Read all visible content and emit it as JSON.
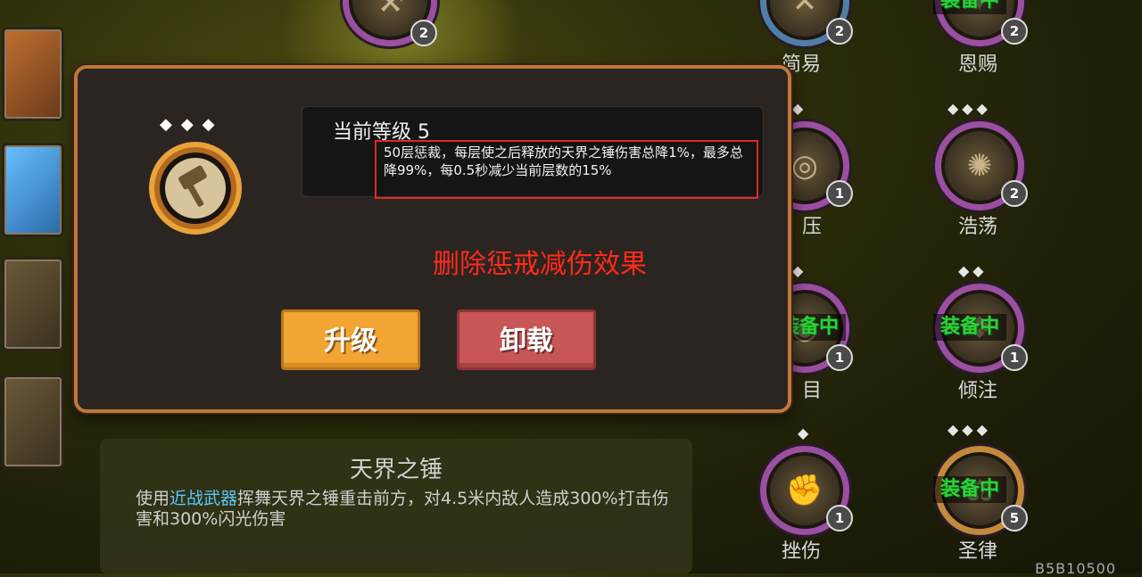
{
  "modal": {
    "level_label": "当前等级 5",
    "effect_desc": "50层惩裁，每层使之后释放的天界之锤伤害总降1%，最多总降99%，每0.5秒减少当前层数的15%",
    "annotation": "删除惩戒减伤效果",
    "upgrade_label": "升级",
    "unload_label": "卸载"
  },
  "skill_panel": {
    "title": "天界之锤",
    "desc_prefix": "使用",
    "desc_highlight": "近战武器",
    "desc_rest": "挥舞天界之锤重击前方，对4.5米内敌人造成300%打击伤害和300%闪光伤害"
  },
  "right_skills": [
    {
      "name": "简易",
      "level": "2",
      "equipped": false
    },
    {
      "name": "恩赐",
      "level": "2",
      "equipped": true,
      "equipped_label": "装备中"
    },
    {
      "name": "压",
      "level": "1",
      "equipped": false
    },
    {
      "name": "浩荡",
      "level": "2",
      "equipped": false
    },
    {
      "name": "目",
      "level": "1",
      "equipped": true,
      "equipped_label": "装备中"
    },
    {
      "name": "倾注",
      "level": "1",
      "equipped": true,
      "equipped_label": "装备中"
    },
    {
      "name": "挫伤",
      "level": "1",
      "equipped": false
    },
    {
      "name": "圣律",
      "level": "5",
      "equipped": true,
      "equipped_label": "装备中"
    }
  ],
  "top_badge_level": "2",
  "corner_text": "B5B10500",
  "colors": {
    "accent_orange": "#f2a533",
    "unload_red": "#c85656",
    "annotation_red": "#ff2a1a",
    "equipped_green": "#2fd12f",
    "highlight_blue": "#5ac8ff"
  },
  "icons": [
    "hammer-icon",
    "skill-emblem-icon"
  ]
}
